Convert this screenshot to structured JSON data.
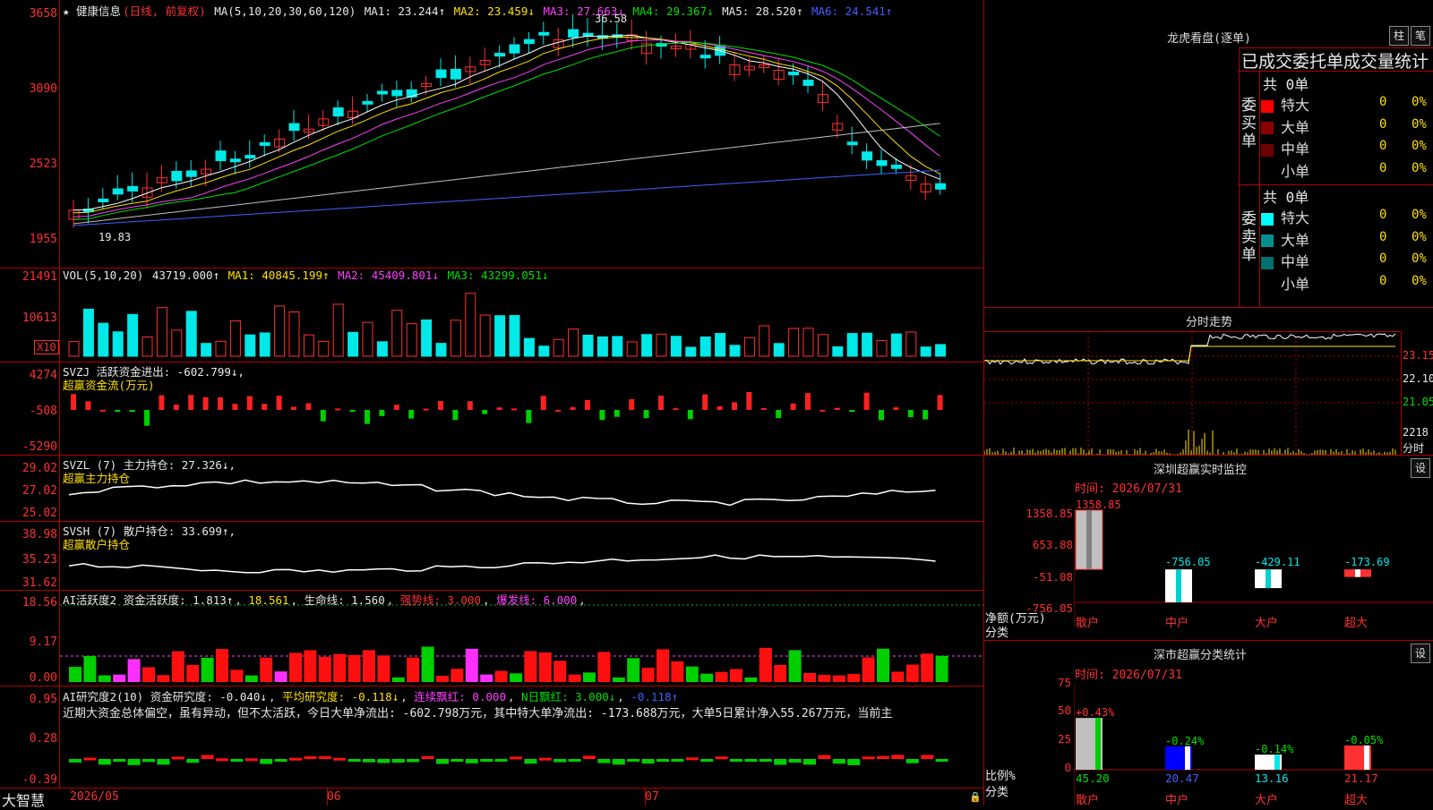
{
  "stock": {
    "name": "★ 健康信息",
    "mode": "(日线, 前复权)"
  },
  "main_chart": {
    "y_labels": [
      "3658",
      "3090",
      "2523",
      "1955"
    ],
    "ma_legend": {
      "label": "MA(5,10,20,30,60,120)",
      "ma1": "MA1: 23.244↑",
      "ma2": "MA2: 23.459↓",
      "ma3": "MA3: 27.663↓",
      "ma4": "MA4: 29.367↓",
      "ma5": "MA5: 28.520↑",
      "ma6": "MA6: 24.541↑"
    },
    "high_marker": "36.58",
    "low_marker": "19.83",
    "colors": {
      "ma1": "#ffffff",
      "ma2": "#ffe000",
      "ma3": "#ff40ff",
      "ma4": "#00e000",
      "ma5": "#c0c0c0",
      "ma6": "#4060ff",
      "up": "#ff3030",
      "down": "#00e8e8"
    }
  },
  "vol_chart": {
    "y_labels": [
      "21491",
      "10613"
    ],
    "x10": "X10",
    "legend": {
      "label": "VOL(5,10,20)",
      "vol": "43719.000↑",
      "ma1": "MA1: 40845.199↑",
      "ma2": "MA2: 45409.801↓",
      "ma3": "MA3: 43299.051↓"
    }
  },
  "svzj": {
    "y_labels": [
      "4274",
      "-508",
      "-5290"
    ],
    "legend": "SVZJ  活跃资金进出: -602.799↓,",
    "subtitle": "超赢资金流(万元)"
  },
  "svzl": {
    "y_labels": [
      "29.02",
      "27.02",
      "25.02"
    ],
    "legend": "SVZL (7) 主力持仓: 27.326↓,",
    "subtitle": "超赢主力持仓"
  },
  "svsh": {
    "y_labels": [
      "38.98",
      "35.23",
      "31.62"
    ],
    "legend": "SVSH (7) 散户持仓: 33.699↑,",
    "subtitle": "超赢散户持仓"
  },
  "ai_active": {
    "y_labels": [
      "18.56",
      "9.17",
      "0.00"
    ],
    "legend": {
      "a": "AI活跃度2 资金活跃度: 1.813↑",
      "b": "18.561",
      "c": "生命线: 1.560",
      "d": "强势线: 3.000",
      "e": "爆发线: 6.000"
    }
  },
  "ai_research": {
    "y_labels": [
      "0.95",
      "0.28",
      "-0.39"
    ],
    "legend": {
      "a": "AI研究度2(10) 资金研究度: -0.040↓",
      "b": "平均研究度: -0.118↓",
      "c": "连续飘红: 0.000",
      "d": "N日飘红: 3.000↓",
      "e": "-0.118↑"
    },
    "comment": "近期大资金总体偏空，虽有异动，但不太活跃，今日大单净流出: -602.798万元，其中特大单净流出: -173.688万元，大单5日累计净入55.267万元，当前主"
  },
  "x_axis": {
    "brand": "大智慧",
    "labels": [
      "2026/05",
      "06",
      "07"
    ]
  },
  "dragon_tiger": {
    "title": "龙虎看盘(逐单)",
    "btn_col": "柱",
    "btn_pen": "笔",
    "header": "已成交委托单成交量统计",
    "buy": {
      "side": "委买单",
      "total": "共 0单",
      "rows": [
        {
          "label": "特大",
          "count": "0",
          "pct": "0%",
          "color": "#ff0000"
        },
        {
          "label": "大单",
          "count": "0",
          "pct": "0%",
          "color": "#8b0000"
        },
        {
          "label": "中单",
          "count": "0",
          "pct": "0%",
          "color": "#700000"
        },
        {
          "label": "小单",
          "count": "0",
          "pct": "0%",
          "color": ""
        }
      ]
    },
    "sell": {
      "side": "委卖单",
      "total": "共 0单",
      "rows": [
        {
          "label": "特大",
          "count": "0",
          "pct": "0%",
          "color": "#00ffff"
        },
        {
          "label": "大单",
          "count": "0",
          "pct": "0%",
          "color": "#009090"
        },
        {
          "label": "中单",
          "count": "0",
          "pct": "0%",
          "color": "#007070"
        },
        {
          "label": "小单",
          "count": "0",
          "pct": "0%",
          "color": ""
        }
      ]
    }
  },
  "intraday": {
    "title": "分时走势",
    "y_labels": [
      "23.15",
      "22.10",
      "21.05",
      "2218",
      "分时"
    ]
  },
  "monitor": {
    "title": "深圳超赢实时监控",
    "btn": "设",
    "time": "时间: 2026/07/31",
    "y_labels": [
      "1358.85",
      "653.88",
      "-51.08",
      "-756.05"
    ],
    "unit": "净额(万元)",
    "cat_label": "分类",
    "bars": [
      {
        "name": "散户",
        "value": 1358.85,
        "label": "1358.85"
      },
      {
        "name": "中户",
        "value": -756.05,
        "label": "-756.05"
      },
      {
        "name": "大户",
        "value": -429.11,
        "label": "-429.11"
      },
      {
        "name": "超大",
        "value": -173.69,
        "label": "-173.69"
      }
    ]
  },
  "class_stats": {
    "title": "深市超赢分类统计",
    "btn": "设",
    "time": "时间: 2026/07/31",
    "y_labels": [
      "75",
      "50",
      "25",
      "0"
    ],
    "unit": "比例%",
    "cat_label": "分类",
    "bars": [
      {
        "name": "散户",
        "value": 45.2,
        "label": "45.20",
        "change": "+0.43%"
      },
      {
        "name": "中户",
        "value": 20.47,
        "label": "20.47",
        "change": "-0.24%"
      },
      {
        "name": "大户",
        "value": 13.16,
        "label": "13.16",
        "change": "-0.14%"
      },
      {
        "name": "超大",
        "value": 21.17,
        "label": "21.17",
        "change": "-0.05%"
      }
    ]
  }
}
